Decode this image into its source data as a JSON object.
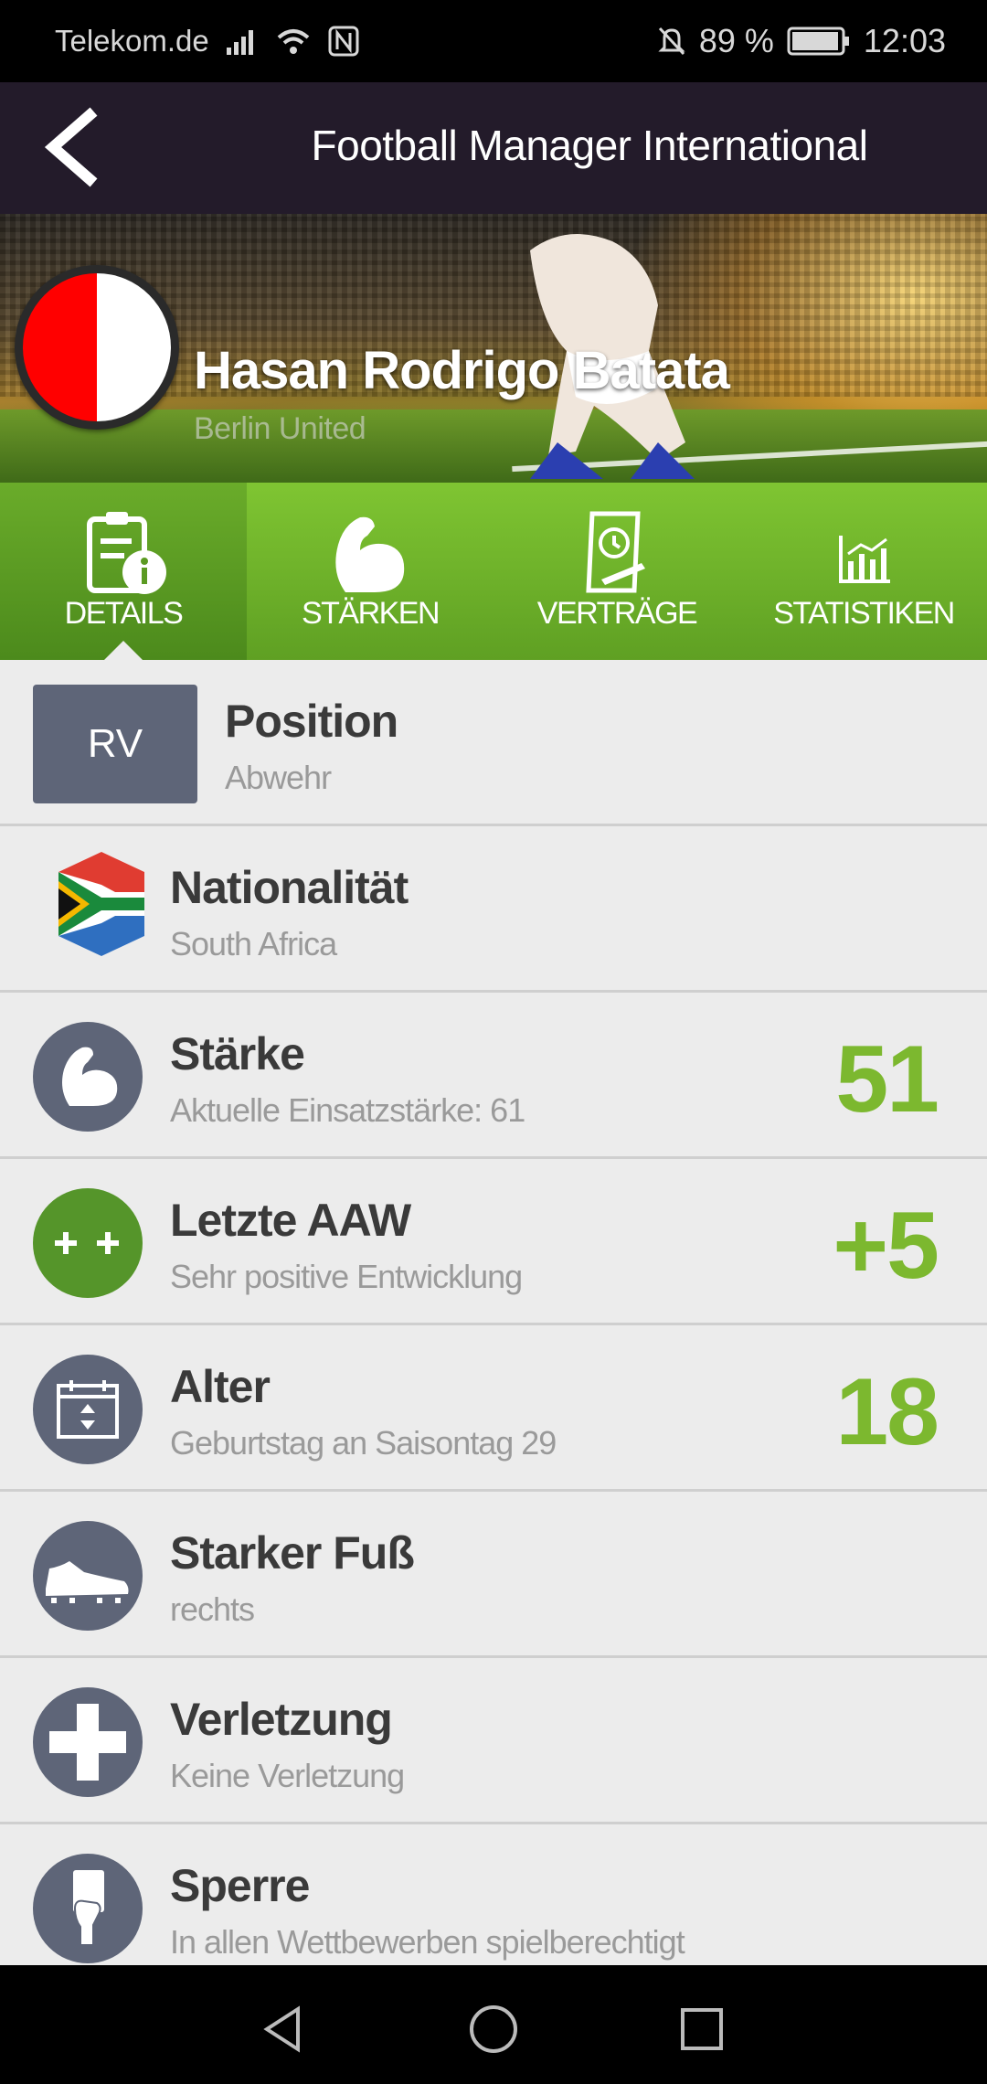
{
  "status_bar": {
    "carrier": "Telekom.de",
    "battery": "89 %",
    "time": "12:03"
  },
  "app_bar": {
    "title": "Football Manager International"
  },
  "hero": {
    "player_name": "Hasan Rodrigo Batata",
    "club": "Berlin United",
    "club_colors": [
      "#ff0000",
      "#ffffff"
    ]
  },
  "tabs": [
    {
      "label": "DETAILS",
      "icon": "clipboard-info-icon",
      "active": true
    },
    {
      "label": "STÄRKEN",
      "icon": "biceps-icon",
      "active": false
    },
    {
      "label": "VERTRÄGE",
      "icon": "contract-clock-icon",
      "active": false
    },
    {
      "label": "STATISTIKEN",
      "icon": "bar-chart-icon",
      "active": false
    }
  ],
  "details": {
    "position": {
      "abbr": "RV",
      "title": "Position",
      "sub": "Abwehr"
    },
    "nationality": {
      "title": "Nationalität",
      "sub": "South Africa",
      "icon": "south-africa-flag-icon"
    },
    "strength": {
      "title": "Stärke",
      "sub": "Aktuelle Einsatzstärke: 61",
      "value": "51",
      "icon": "biceps-icon"
    },
    "last_aaw": {
      "title": "Letzte AAW",
      "sub": "Sehr positive Entwicklung",
      "value": "+5",
      "icon": "plus-plus-icon"
    },
    "age": {
      "title": "Alter",
      "sub": "Geburtstag an Saisontag 29",
      "value": "18",
      "icon": "calendar-icon"
    },
    "foot": {
      "title": "Starker Fuß",
      "sub": "rechts",
      "icon": "football-boot-icon"
    },
    "injury": {
      "title": "Verletzung",
      "sub": "Keine Verletzung",
      "icon": "medical-cross-icon"
    },
    "suspension": {
      "title": "Sperre",
      "sub": "In allen Wettbewerben spielberechtigt",
      "icon": "referee-card-icon"
    }
  },
  "colors": {
    "accent_green": "#7cb82f",
    "tab_green": "#6fb22a",
    "icon_slate": "#5e6578",
    "app_bar": "#231b2a"
  }
}
